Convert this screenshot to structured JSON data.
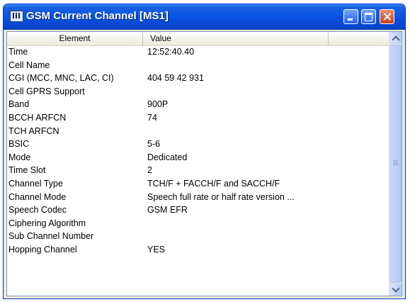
{
  "window": {
    "title": "GSM Current Channel [MS1]",
    "icon": "app-window-icon",
    "controls": [
      "minimize-icon",
      "maximize-icon",
      "close-icon"
    ]
  },
  "table": {
    "headers": {
      "element": "Element",
      "value": "Value"
    },
    "rows": [
      {
        "element": "Time",
        "value": "12:52:40.40"
      },
      {
        "element": "Cell Name",
        "value": ""
      },
      {
        "element": "CGI (MCC, MNC, LAC, CI)",
        "value": "404 59 42 931"
      },
      {
        "element": "Cell GPRS Support",
        "value": ""
      },
      {
        "element": "Band",
        "value": "900P"
      },
      {
        "element": "BCCH ARFCN",
        "value": "74"
      },
      {
        "element": "TCH ARFCN",
        "value": ""
      },
      {
        "element": "BSIC",
        "value": "5-6"
      },
      {
        "element": "Mode",
        "value": "Dedicated"
      },
      {
        "element": "Time Slot",
        "value": "2"
      },
      {
        "element": "Channel Type",
        "value": "TCH/F + FACCH/F and SACCH/F"
      },
      {
        "element": "Channel Mode",
        "value": "Speech full rate or half rate version ..."
      },
      {
        "element": "Speech Codec",
        "value": "GSM EFR"
      },
      {
        "element": "Ciphering Algorithm",
        "value": ""
      },
      {
        "element": "Sub Channel Number",
        "value": ""
      },
      {
        "element": "Hopping Channel",
        "value": "YES"
      }
    ]
  },
  "colors": {
    "titlebar": "#0a54e6",
    "window_frame": "#0831d9",
    "close_button": "#c4421c"
  }
}
